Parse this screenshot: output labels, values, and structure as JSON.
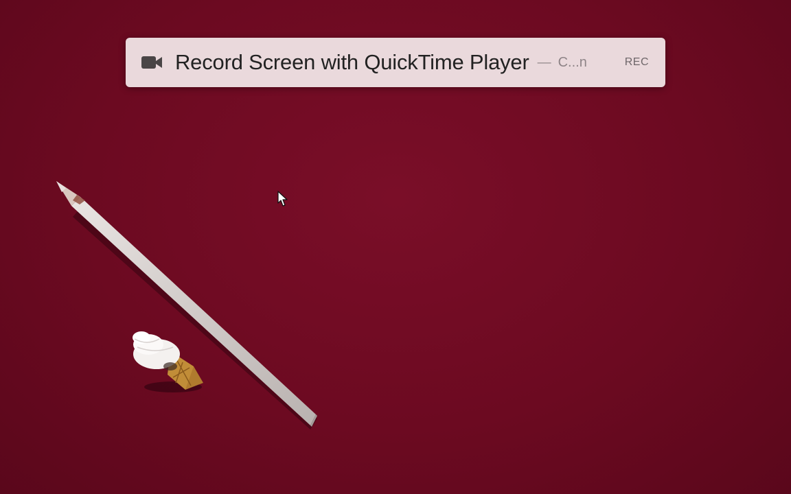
{
  "spotlight": {
    "query": "Record Screen with QuickTime Player",
    "separator": "—",
    "completion": "C...n",
    "shortcut": "REC",
    "icon": "video-camera-icon"
  },
  "colors": {
    "background": "#6e0a22",
    "bar_background": "#ead9dc",
    "query_text": "#222222",
    "secondary_text": "#8e8487",
    "icon": "#4a4546"
  },
  "decor": {
    "objects": [
      "pencil",
      "ice-cream-eraser",
      "mouse-cursor"
    ]
  }
}
